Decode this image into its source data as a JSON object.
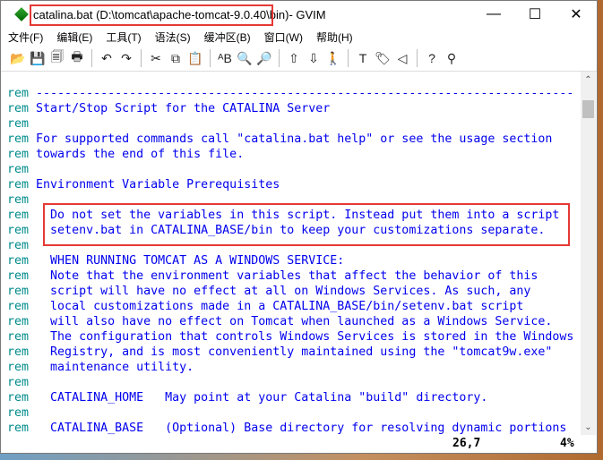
{
  "window": {
    "title": "catalina.bat (D:\\tomcat\\apache-tomcat-9.0.40\\bin)",
    "app": " - GVIM",
    "minimize": "—",
    "maximize": "☐",
    "close": "✕"
  },
  "menu": [
    "文件(F)",
    "编辑(E)",
    "工具(T)",
    "语法(S)",
    "缓冲区(B)",
    "窗口(W)",
    "帮助(H)"
  ],
  "toolbar": [
    {
      "name": "open-icon",
      "glyph": "📂"
    },
    {
      "name": "save-icon",
      "glyph": "💾"
    },
    {
      "name": "save-all-icon",
      "glyph": "🗐"
    },
    {
      "name": "print-icon",
      "glyph": "🖶"
    },
    "sep",
    {
      "name": "undo-icon",
      "glyph": "↶"
    },
    {
      "name": "redo-icon",
      "glyph": "↷"
    },
    "sep",
    {
      "name": "cut-icon",
      "glyph": "✂"
    },
    {
      "name": "copy-icon",
      "glyph": "⧉"
    },
    {
      "name": "paste-icon",
      "glyph": "📋"
    },
    "sep",
    {
      "name": "replace-icon",
      "glyph": "ᴬB"
    },
    {
      "name": "find-next-icon",
      "glyph": "🔍"
    },
    {
      "name": "find-prev-icon",
      "glyph": "🔎"
    },
    "sep",
    {
      "name": "load-session-icon",
      "glyph": "⇧"
    },
    {
      "name": "save-session-icon",
      "glyph": "⇩"
    },
    {
      "name": "run-script-icon",
      "glyph": "🚶"
    },
    "sep",
    {
      "name": "make-icon",
      "glyph": "T"
    },
    {
      "name": "build-tags-icon",
      "glyph": "🏷"
    },
    {
      "name": "tag-jump-icon",
      "glyph": "◁"
    },
    "sep",
    {
      "name": "help-icon",
      "glyph": "?"
    },
    {
      "name": "find-help-icon",
      "glyph": "⚲"
    }
  ],
  "lines": [
    [
      "rem",
      " ---------------------------------------------------------------------------"
    ],
    [
      "rem",
      " Start/Stop Script for the CATALINA Server"
    ],
    [
      "rem",
      ""
    ],
    [
      "rem",
      " For supported commands call \"catalina.bat help\" or see the usage section"
    ],
    [
      "rem",
      " towards the end of this file."
    ],
    [
      "rem",
      ""
    ],
    [
      "rem",
      " Environment Variable Prerequisites"
    ],
    [
      "rem",
      ""
    ],
    [
      "rem",
      "   Do not set the variables in this script. Instead put them into a script"
    ],
    [
      "rem",
      "   setenv.bat in CATALINA_BASE/bin to keep your customizations separate."
    ],
    [
      "rem",
      ""
    ],
    [
      "rem",
      "   WHEN RUNNING TOMCAT AS A WINDOWS SERVICE:"
    ],
    [
      "rem",
      "   Note that the environment variables that affect the behavior of this"
    ],
    [
      "rem",
      "   script will have no effect at all on Windows Services. As such, any"
    ],
    [
      "rem",
      "   local customizations made in a CATALINA_BASE/bin/setenv.bat script"
    ],
    [
      "rem",
      "   will also have no effect on Tomcat when launched as a Windows Service."
    ],
    [
      "rem",
      "   The configuration that controls Windows Services is stored in the Windows"
    ],
    [
      "rem",
      "   Registry, and is most conveniently maintained using the \"tomcat9w.exe\""
    ],
    [
      "rem",
      "   maintenance utility."
    ],
    [
      "rem",
      ""
    ],
    [
      "rem",
      "   CATALINA_HOME   May point at your Catalina \"build\" directory."
    ],
    [
      "rem",
      ""
    ],
    [
      "rem",
      "   CATALINA_BASE   (Optional) Base directory for resolving dynamic portions"
    ]
  ],
  "status": {
    "position": "26,7",
    "percent": "4%"
  },
  "scroll": {
    "up": "⌃",
    "down": "⌄",
    "position_percent": 4
  }
}
